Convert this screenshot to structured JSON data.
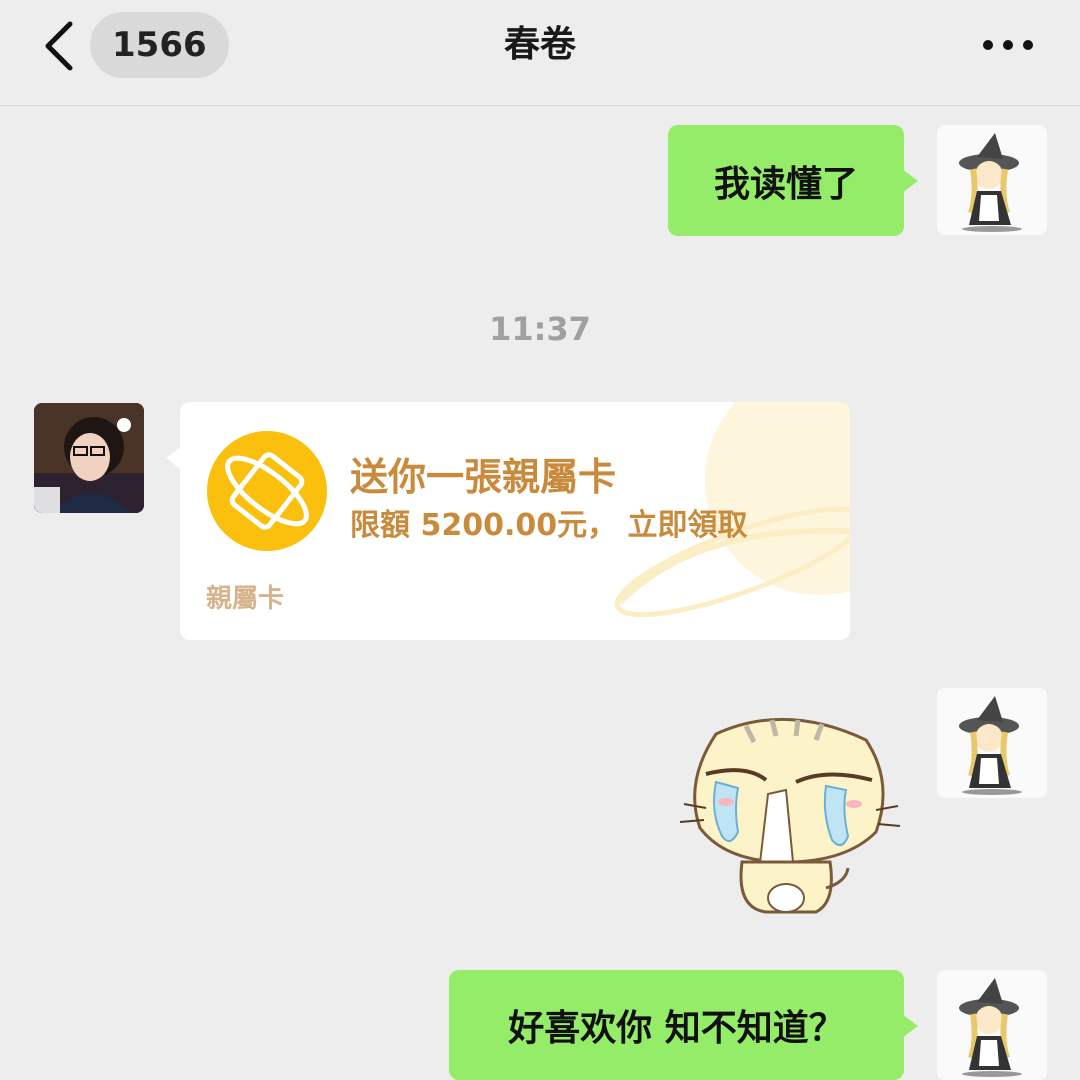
{
  "header": {
    "back_icon": "chevron-left-icon",
    "unread_count": "1566",
    "title": "春卷",
    "more_icon": "more-dots-icon"
  },
  "messages": [
    {
      "from": "me",
      "type": "text",
      "text": "我读懂了"
    },
    {
      "type": "timestamp",
      "text": "11:37"
    },
    {
      "from": "other",
      "type": "family_card",
      "title": "送你一張親屬卡",
      "subtitle": "限額 5200.00元， 立即領取",
      "footer": "親屬卡"
    },
    {
      "from": "me",
      "type": "sticker",
      "sticker": "crying-cat-sticker"
    },
    {
      "from": "me",
      "type": "text",
      "text": "好喜欢你 知不知道？"
    }
  ],
  "colors": {
    "background": "#ededed",
    "my_bubble": "#95ec69",
    "card_accent": "#c98a3c",
    "card_icon": "#fbbf0d"
  }
}
